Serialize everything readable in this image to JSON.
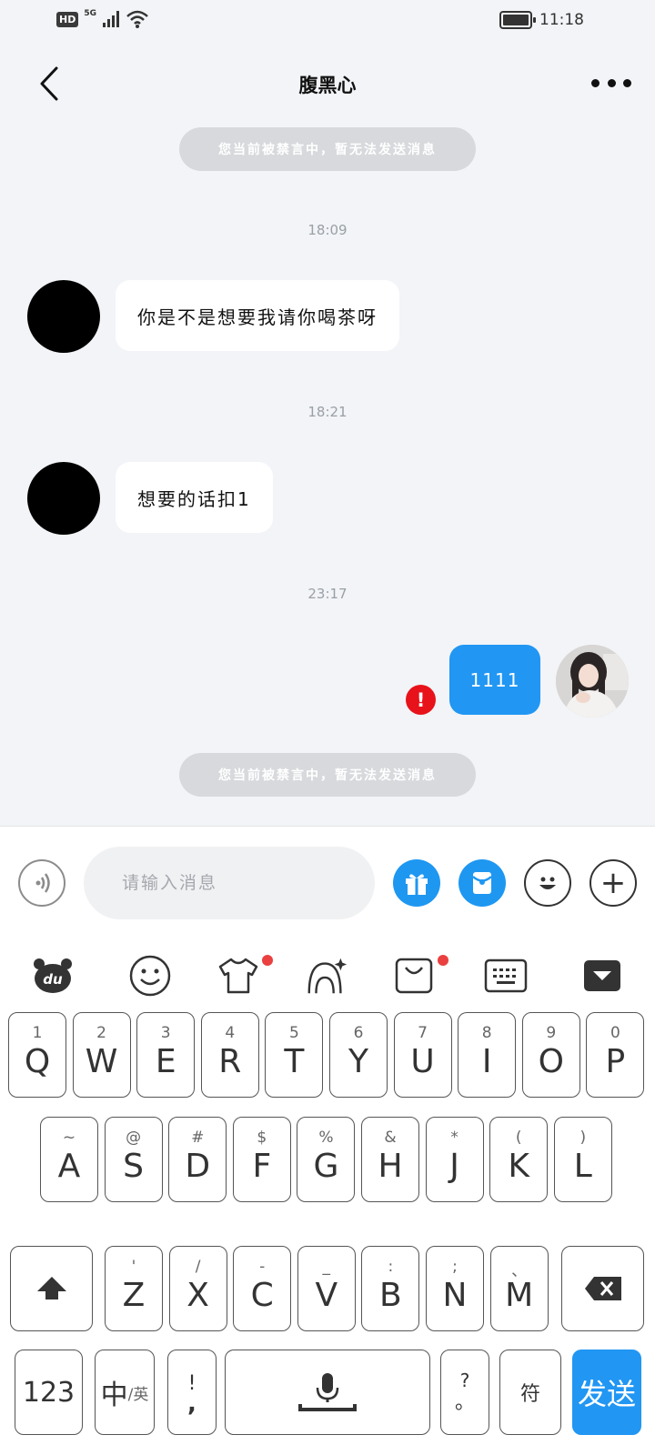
{
  "status_bar": {
    "hd": "HD",
    "network": "5G",
    "time": "11:18"
  },
  "header": {
    "title": "腹黑心"
  },
  "chat": {
    "system_notice_top": "您当前被禁言中，暂无法发送消息",
    "time_1": "18:09",
    "message_1": "你是不是想要我请你喝茶呀",
    "time_2": "18:21",
    "message_2": "想要的话扣1",
    "time_3": "23:17",
    "my_message": "1111",
    "error_mark": "!",
    "system_notice_bottom": "您当前被禁言中，暂无法发送消息"
  },
  "input_bar": {
    "placeholder": "请输入消息",
    "plus": "+"
  },
  "keyboard": {
    "row1": [
      {
        "main": "Q",
        "sub": "1"
      },
      {
        "main": "W",
        "sub": "2"
      },
      {
        "main": "E",
        "sub": "3"
      },
      {
        "main": "R",
        "sub": "4"
      },
      {
        "main": "T",
        "sub": "5"
      },
      {
        "main": "Y",
        "sub": "6"
      },
      {
        "main": "U",
        "sub": "7"
      },
      {
        "main": "I",
        "sub": "8"
      },
      {
        "main": "O",
        "sub": "9"
      },
      {
        "main": "P",
        "sub": "0"
      }
    ],
    "row2": [
      {
        "main": "A",
        "sub": "~"
      },
      {
        "main": "S",
        "sub": "@"
      },
      {
        "main": "D",
        "sub": "#"
      },
      {
        "main": "F",
        "sub": "$"
      },
      {
        "main": "G",
        "sub": "%"
      },
      {
        "main": "H",
        "sub": "&"
      },
      {
        "main": "J",
        "sub": "*"
      },
      {
        "main": "K",
        "sub": "("
      },
      {
        "main": "L",
        "sub": ")"
      }
    ],
    "row3": [
      {
        "main": "Z",
        "sub": "'"
      },
      {
        "main": "X",
        "sub": "/"
      },
      {
        "main": "C",
        "sub": "-"
      },
      {
        "main": "V",
        "sub": "_"
      },
      {
        "main": "B",
        "sub": ":"
      },
      {
        "main": "N",
        "sub": ";"
      },
      {
        "main": "M",
        "sub": "、"
      }
    ],
    "num_key": "123",
    "lang_key_main": "中",
    "lang_key_sub": "/英",
    "punct_key_top": "!",
    "punct_key_bottom": ",",
    "punct2_key_top": "?",
    "punct2_key_bottom": "。",
    "symbol_key": "符",
    "send_key": "发送"
  },
  "colors": {
    "accent": "#2196f3",
    "error": "#e8121a",
    "badge_dot": "#ea4040"
  }
}
